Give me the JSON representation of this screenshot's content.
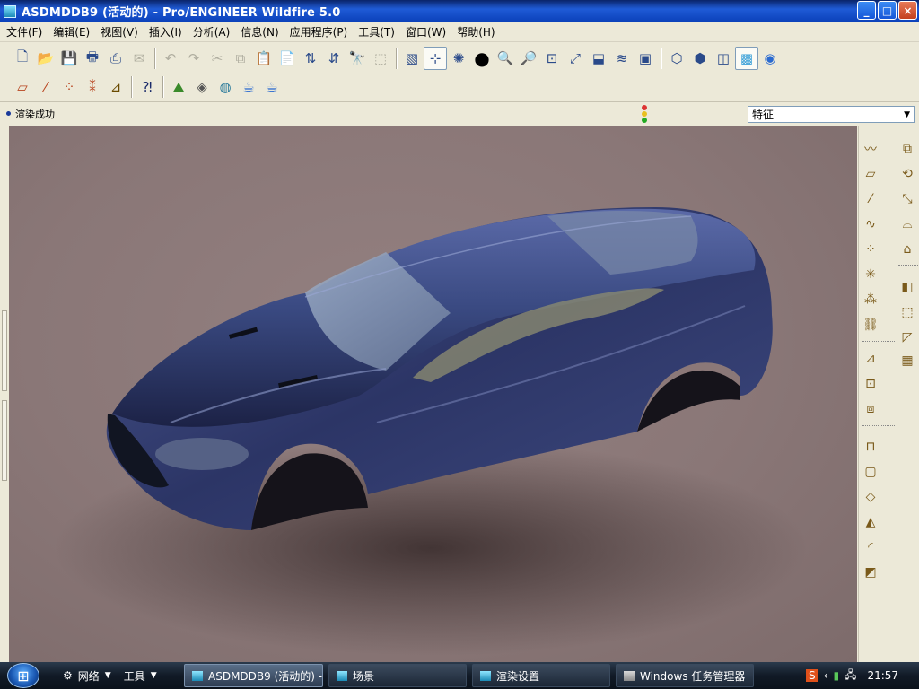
{
  "window": {
    "title": "ASDMDDB9 (活动的) - Pro/ENGINEER Wildfire 5.0",
    "controls": [
      "_",
      "□",
      "×"
    ]
  },
  "menu": [
    "文件(F)",
    "编辑(E)",
    "视图(V)",
    "插入(I)",
    "分析(A)",
    "信息(N)",
    "应用程序(P)",
    "工具(T)",
    "窗口(W)",
    "帮助(H)"
  ],
  "message": {
    "text": "渲染成功"
  },
  "filter": {
    "selected": "特征"
  },
  "taskbar": {
    "start_icon": "windows-start-orb",
    "quicklaunch": [
      "网络",
      "工具"
    ],
    "tasks": [
      {
        "label": "ASDMDDB9 (活动的) -...",
        "active": true
      },
      {
        "label": "场景",
        "active": false
      },
      {
        "label": "渲染设置",
        "active": false
      },
      {
        "label": "Windows 任务管理器",
        "active": false
      }
    ],
    "clock": "21:57"
  },
  "viewport": {
    "model": "car-body-render",
    "background_color": "#8a7777",
    "body_color": "#3a4a82"
  },
  "colors": {
    "titlebar": "#1F5BD6",
    "chrome": "#ECE9D8",
    "taskbar": "#111a26"
  }
}
